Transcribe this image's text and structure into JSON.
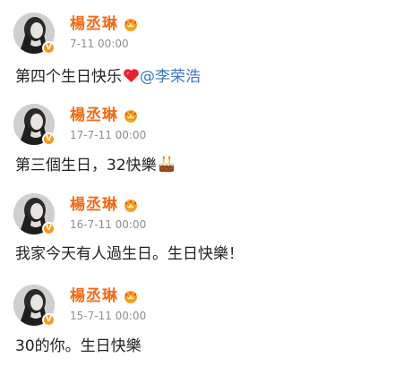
{
  "posts": [
    {
      "username": "楊丞琳",
      "time": "7-11 00:00",
      "text": "第四个生日快乐",
      "emoji": "heart-icon",
      "mention": "@李荣浩"
    },
    {
      "username": "楊丞琳",
      "time": "17-7-11 00:00",
      "text": "第三個生日，32快樂",
      "emoji": "cake-icon"
    },
    {
      "username": "楊丞琳",
      "time": "16-7-11 00:00",
      "text": "我家今天有人過生日。生日快樂！"
    },
    {
      "username": "楊丞琳",
      "time": "15-7-11 00:00",
      "text": "30的你。生日快樂"
    }
  ],
  "colors": {
    "username": "#f26b17",
    "time": "#8e8e8e",
    "text": "#222222",
    "mention": "#3b76c4",
    "verified_badge": "#f79a1a",
    "heart": "#e8212e"
  },
  "icons": {
    "avatar": "avatar",
    "verified": "verified-badge-icon",
    "vip": "vip-crown-icon"
  }
}
